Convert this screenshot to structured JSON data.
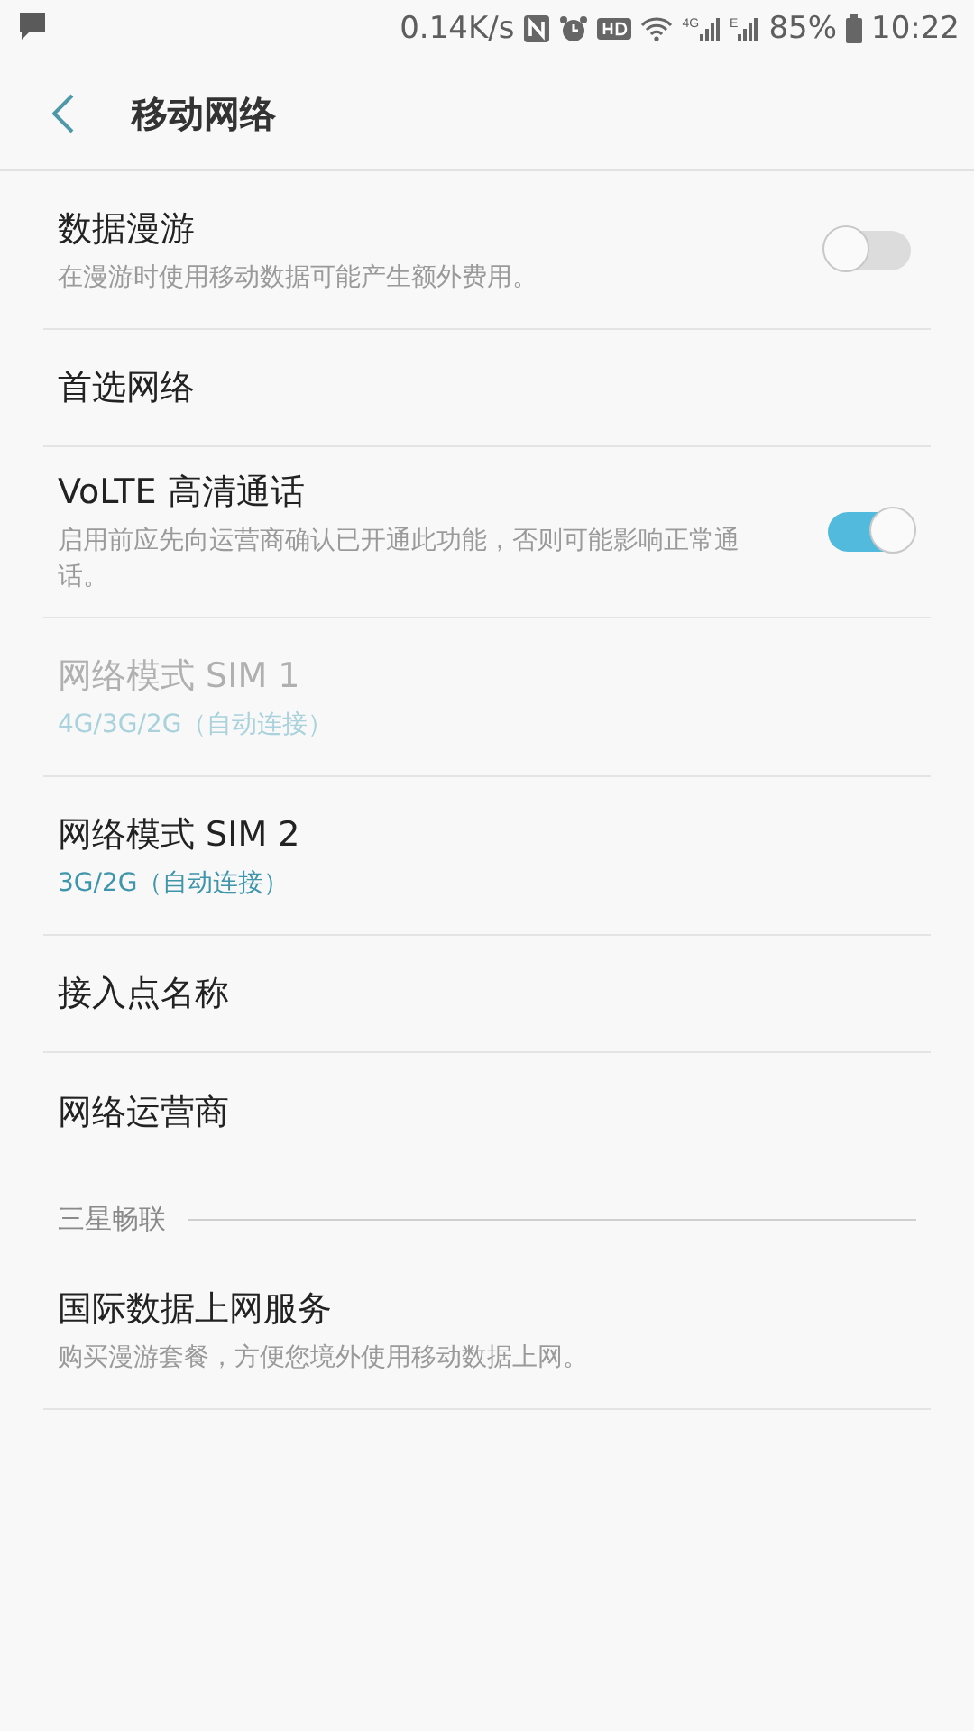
{
  "status_bar": {
    "speed": "0.14K/s",
    "network_4g": "4G",
    "network_e": "E",
    "battery": "85%",
    "time": "10:22"
  },
  "header": {
    "title": "移动网络"
  },
  "items": [
    {
      "kind": "toggle",
      "title": "数据漫游",
      "subtitle": "在漫游时使用移动数据可能产生额外费用。",
      "on": false,
      "disabled": false
    },
    {
      "kind": "plain",
      "title": "首选网络",
      "disabled": false
    },
    {
      "kind": "toggle",
      "title": "VoLTE 高清通话",
      "subtitle": "启用前应先向运营商确认已开通此功能，否则可能影响正常通话。",
      "on": true,
      "disabled": false
    },
    {
      "kind": "choice",
      "title": "网络模式 SIM 1",
      "subtitle": "4G/3G/2G（自动连接）",
      "disabled": true
    },
    {
      "kind": "choice",
      "title": "网络模式 SIM 2",
      "subtitle": "3G/2G（自动连接）",
      "disabled": false
    },
    {
      "kind": "plain",
      "title": "接入点名称",
      "disabled": false
    },
    {
      "kind": "plain",
      "title": "网络运营商",
      "disabled": false
    },
    {
      "kind": "section",
      "title": "三星畅联"
    },
    {
      "kind": "plain",
      "title": "国际数据上网服务",
      "subtitle": "购买漫游套餐，方便您境外使用移动数据上网。",
      "disabled": false
    }
  ]
}
